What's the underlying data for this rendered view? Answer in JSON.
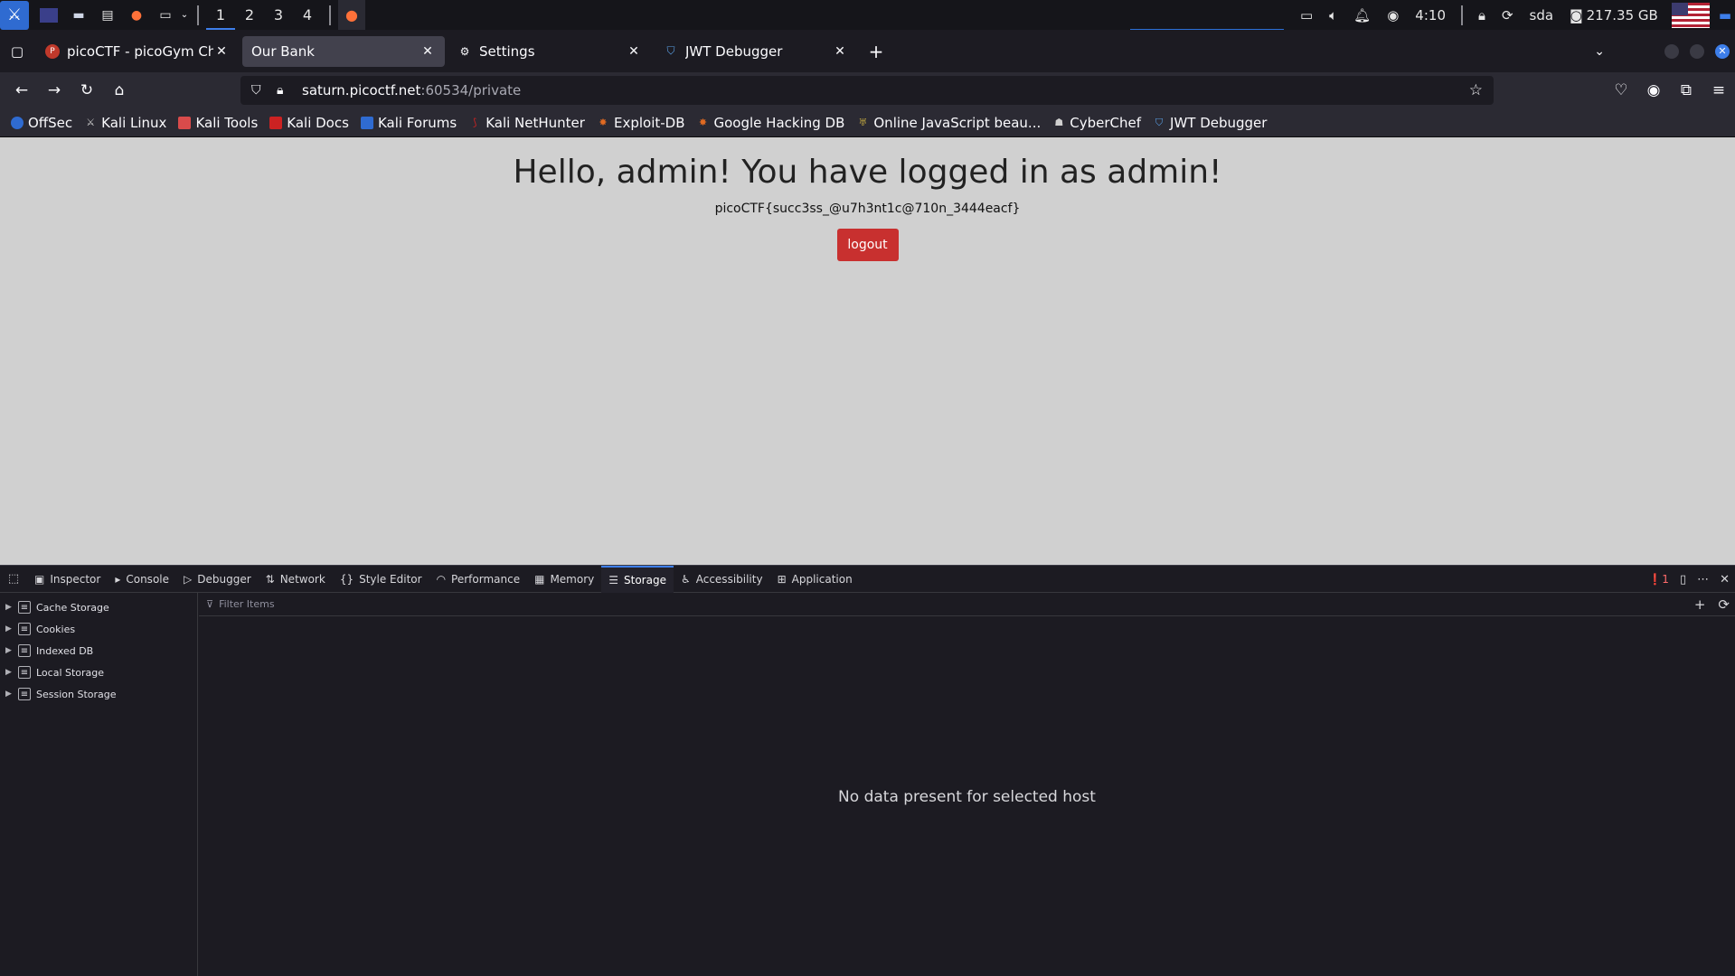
{
  "taskbar": {
    "workspaces": [
      "1",
      "2",
      "3",
      "4"
    ],
    "time": "4:10",
    "user": "sda",
    "disk": "217.35 GB"
  },
  "tabs": [
    {
      "title": "picoCTF - picoGym Challenges",
      "icon": "picoctf-icon"
    },
    {
      "title": "Our Bank",
      "icon": ""
    },
    {
      "title": "Settings",
      "icon": "gear-icon"
    },
    {
      "title": "JWT Debugger",
      "icon": "shield-icon"
    }
  ],
  "url": {
    "host": "saturn.picoctf.net",
    "path": ":60534/private"
  },
  "bookmarks": [
    {
      "label": "OffSec",
      "color": "#2f6bd1"
    },
    {
      "label": "Kali Linux",
      "color": "#cfcfcf"
    },
    {
      "label": "Kali Tools",
      "color": "#d94b4b"
    },
    {
      "label": "Kali Docs",
      "color": "#c22"
    },
    {
      "label": "Kali Forums",
      "color": "#2f6bd1"
    },
    {
      "label": "Kali NetHunter",
      "color": "#c22"
    },
    {
      "label": "Exploit-DB",
      "color": "#e06a22"
    },
    {
      "label": "Google Hacking DB",
      "color": "#e06a22"
    },
    {
      "label": "Online JavaScript beau...",
      "color": "#b8a040"
    },
    {
      "label": "CyberChef",
      "color": "#cfcfcf"
    },
    {
      "label": "JWT Debugger",
      "color": "#5aa0e6"
    }
  ],
  "page": {
    "greeting": "Hello, admin! You have logged in as admin!",
    "flag": "picoCTF{succ3ss_@u7h3nt1c@710n_3444eacf}",
    "logout_label": "logout"
  },
  "devtools": {
    "tabs": [
      "Inspector",
      "Console",
      "Debugger",
      "Network",
      "Style Editor",
      "Performance",
      "Memory",
      "Storage",
      "Accessibility",
      "Application"
    ],
    "error_count": "1",
    "storage_tree": [
      "Cache Storage",
      "Cookies",
      "Indexed DB",
      "Local Storage",
      "Session Storage"
    ],
    "filter_placeholder": "Filter Items",
    "empty_message": "No data present for selected host"
  }
}
